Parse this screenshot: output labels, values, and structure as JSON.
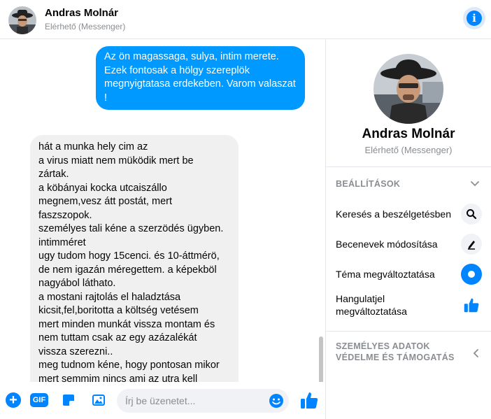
{
  "header": {
    "name": "Andras Molnár",
    "status": "Elérhető (Messenger)"
  },
  "messages": {
    "outgoing": "Az ön magassaga, sulya, intim merete. Ezek fontosak a hölgy szereplök megnyigtatasa erdekeben. Varom valaszat !",
    "incoming_lines": [
      "hát a munka hely cim az",
      "a virus miatt nem müködik mert be",
      "zártak.",
      "a köbányai kocka utcaiszállo",
      "megnem,vesz átt postát, mert",
      "faszszopok.",
      "személyes tali kéne a szerzödés ügyben.",
      "intimméret",
      "ugy tudom hogy 15cenci. és 10-áttmérö,",
      "de nem igazán méregettem. a képekböl",
      "nagyábol láthato.",
      "a mostani rajtolás el haladztása",
      "kicsit,fel,boritotta a költség vetésem",
      "mert minden munkát vissza montam és",
      "nem tuttam csak az egy azázalékát",
      "vissza szerezni..",
      "meg tudnom kéne, hogy pontosan mikor",
      "mert semmim nincs ami az utra kell"
    ]
  },
  "composer": {
    "placeholder": "Írj be üzenetet...",
    "gif_label": "GIF"
  },
  "panel": {
    "name": "Andras Molnár",
    "status": "Elérhető (Messenger)",
    "settings_header": "BEÁLLÍTÁSOK",
    "items": [
      {
        "label": "Keresés a beszélgetésben",
        "icon": "search-icon"
      },
      {
        "label": "Becenevek módosítása",
        "icon": "pencil-icon"
      },
      {
        "label": "Téma megváltoztatása",
        "icon": "theme-icon"
      },
      {
        "label": "Hangulatjel megváltoztatása",
        "icon": "thumbs-up-icon"
      }
    ],
    "privacy_header": "SZEMÉLYES ADATOK VÉDELME ÉS TÁMOGATÁS"
  },
  "colors": {
    "accent": "#0084ff",
    "bubble_out": "#0099ff",
    "bubble_in": "#f0f0f0"
  }
}
